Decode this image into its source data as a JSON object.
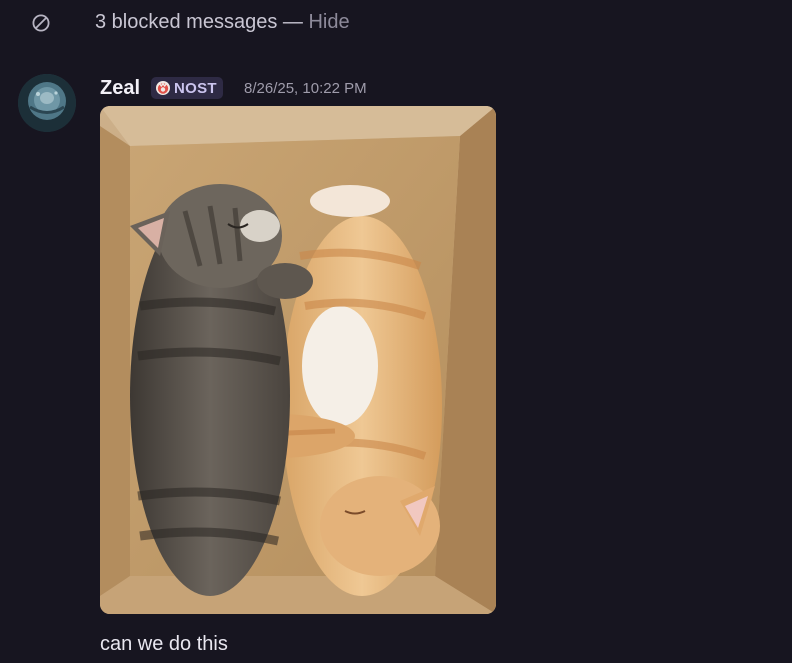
{
  "blocked": {
    "text": "3 blocked messages",
    "dash": " — ",
    "hide_label": "Hide"
  },
  "message": {
    "author": "Zeal",
    "tag_label": "NOST",
    "timestamp": "8/26/25, 10:22 PM",
    "caption": "can we do this",
    "attachment_icon": "photo-attachment"
  },
  "colors": {
    "background": "#171520",
    "tag_background": "#2e2a44",
    "tag_text": "#cbc4ee",
    "muted_text": "#9f9cab"
  }
}
